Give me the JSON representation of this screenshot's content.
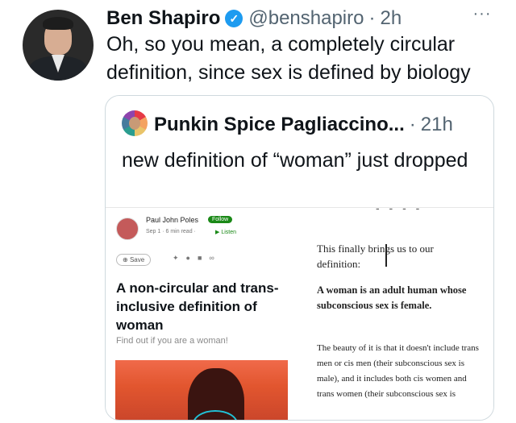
{
  "tweet": {
    "author_name": "Ben Shapiro",
    "handle": "@benshapiro",
    "separator": "·",
    "time": "2h",
    "more": "···",
    "text": "Oh, so you mean, a completely circular definition, since sex is defined by biology"
  },
  "quoted": {
    "author_name": "Punkin Spice Pagliaccino...",
    "separator": "·",
    "time": "21h",
    "text": "new definition of “woman” just dropped",
    "screenshot": {
      "author": "Paul John Poles",
      "follow_label": "Follow",
      "meta": "Sep 1 · 6 min read ·",
      "listen_label": "Listen",
      "save_label": "Save",
      "title": "A non-circular and trans-inclusive definition of woman",
      "subtitle": "Find out if you are a woman!",
      "intro": "This finally brings us to our definition:",
      "definition": "A woman is an adult human whose subconscious sex is female.",
      "body": "The beauty of it is that it doesn't include trans men or cis men (their subconscious sex is male), and it includes both cis women and trans women (their subconscious sex is"
    }
  },
  "icons": {
    "verified": "verified-badge-icon",
    "more": "more-icon"
  },
  "colors": {
    "verified_blue": "#1d9bf0",
    "secondary_text": "#536471",
    "medium_green": "#1a8917"
  }
}
